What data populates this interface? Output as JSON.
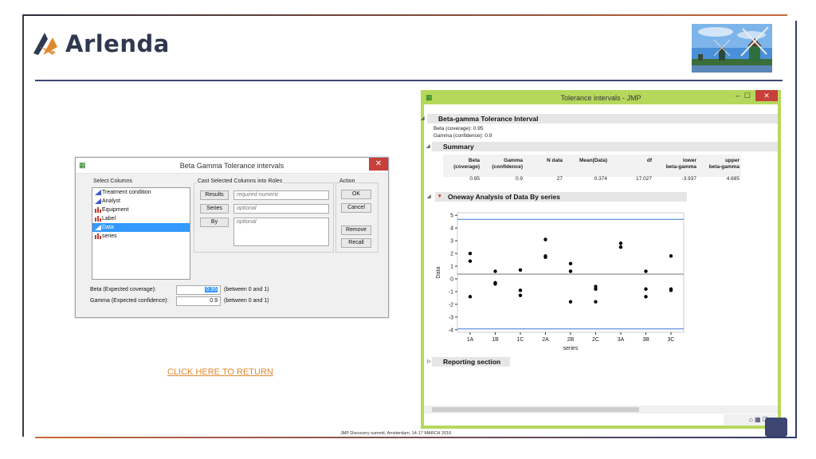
{
  "brand": {
    "name": "Arlenda"
  },
  "footer": {
    "text": "JMP Discovery summit, Amsterdam, 14-17 MARCH 2016"
  },
  "link": {
    "return_label": "CLICK HERE TO RETURN"
  },
  "colors": {
    "brand_dark": "#2f3850",
    "accent_orange": "#e0892f",
    "jmp_frame": "#b5d85c",
    "close_red": "#c8403a"
  },
  "dialog": {
    "title": "Beta Gamma Tolerance intervals",
    "close": "✕",
    "select_columns_label": "Select Columns",
    "columns": [
      {
        "label": "Treatment condition",
        "icon": "continuous-icon"
      },
      {
        "label": "Analyst",
        "icon": "continuous-icon"
      },
      {
        "label": "Equipment",
        "icon": "nominal-icon"
      },
      {
        "label": "Label",
        "icon": "nominal-icon"
      },
      {
        "label": "Data",
        "icon": "continuous-icon",
        "selected": true
      },
      {
        "label": "series",
        "icon": "nominal-icon"
      }
    ],
    "cast_label": "Cast Selected Columns into Roles",
    "roles": [
      {
        "button": "Results",
        "field": "required numeric"
      },
      {
        "button": "Series",
        "field": "optional"
      },
      {
        "button": "By",
        "field": "optional"
      }
    ],
    "action_label": "Action",
    "actions": [
      "OK",
      "Cancel",
      "Remove",
      "Recall"
    ],
    "beta_label": "Beta (Expected coverage):",
    "beta_value": "0.95",
    "beta_hint": "(between 0 and 1)",
    "gamma_label": "Gamma (Expected confidence):",
    "gamma_value": "0.9",
    "gamma_hint": "(between 0 and 1)"
  },
  "jmp": {
    "title": "Tolerance intervals - JMP",
    "minimize": "–",
    "maximize": "☐",
    "close": "✕",
    "section_title": "Beta-gamma Tolerance Interval",
    "beta_line": "Beta (coverage): 0.95",
    "gamma_line": "Gamma (confidence): 0.9",
    "summary_title": "Summary",
    "summary_headers": [
      [
        "Beta",
        "(coverage)"
      ],
      [
        "Gamma",
        "(confidence)"
      ],
      [
        "",
        "N data"
      ],
      [
        "",
        "Mean(Data)"
      ],
      [
        "",
        "df"
      ],
      [
        "lower",
        "beta-gamma"
      ],
      [
        "upper",
        "beta-gamma"
      ]
    ],
    "summary_values": [
      "0.95",
      "0.9",
      "27",
      "0.374",
      "17.027",
      "-3.937",
      "4.685"
    ],
    "oneway_title": "Oneway Analysis of Data By series",
    "reporting_title": "Reporting section"
  },
  "chart_data": {
    "type": "scatter",
    "title": "",
    "xlabel": "series",
    "ylabel": "Data",
    "categories": [
      "1A",
      "1B",
      "1C",
      "2A",
      "2B",
      "2C",
      "3A",
      "3B",
      "3C"
    ],
    "ylim": [
      -4.2,
      5.2
    ],
    "yticks": [
      5,
      4,
      3,
      2,
      1,
      0,
      -1,
      -2,
      -3,
      -4
    ],
    "reference_lines": {
      "mean": 0.374,
      "lower": -3.937,
      "upper": 4.685
    },
    "points": [
      {
        "x": "1A",
        "y": 2.0
      },
      {
        "x": "1A",
        "y": 1.4
      },
      {
        "x": "1A",
        "y": -1.4
      },
      {
        "x": "1B",
        "y": 0.6
      },
      {
        "x": "1B",
        "y": -0.3
      },
      {
        "x": "1B",
        "y": -0.4
      },
      {
        "x": "1C",
        "y": 0.7
      },
      {
        "x": "1C",
        "y": -0.9
      },
      {
        "x": "1C",
        "y": -1.3
      },
      {
        "x": "2A",
        "y": 3.1
      },
      {
        "x": "2A",
        "y": 1.8
      },
      {
        "x": "2A",
        "y": 1.7
      },
      {
        "x": "2B",
        "y": 1.2
      },
      {
        "x": "2B",
        "y": 0.6
      },
      {
        "x": "2B",
        "y": -1.8
      },
      {
        "x": "2C",
        "y": -0.6
      },
      {
        "x": "2C",
        "y": -0.8
      },
      {
        "x": "2C",
        "y": -1.8
      },
      {
        "x": "3A",
        "y": 2.8
      },
      {
        "x": "3A",
        "y": 2.5
      },
      {
        "x": "3B",
        "y": 0.6
      },
      {
        "x": "3B",
        "y": -0.8
      },
      {
        "x": "3B",
        "y": -1.4
      },
      {
        "x": "3C",
        "y": 1.8
      },
      {
        "x": "3C",
        "y": -0.8
      },
      {
        "x": "3C",
        "y": -0.9
      }
    ]
  }
}
